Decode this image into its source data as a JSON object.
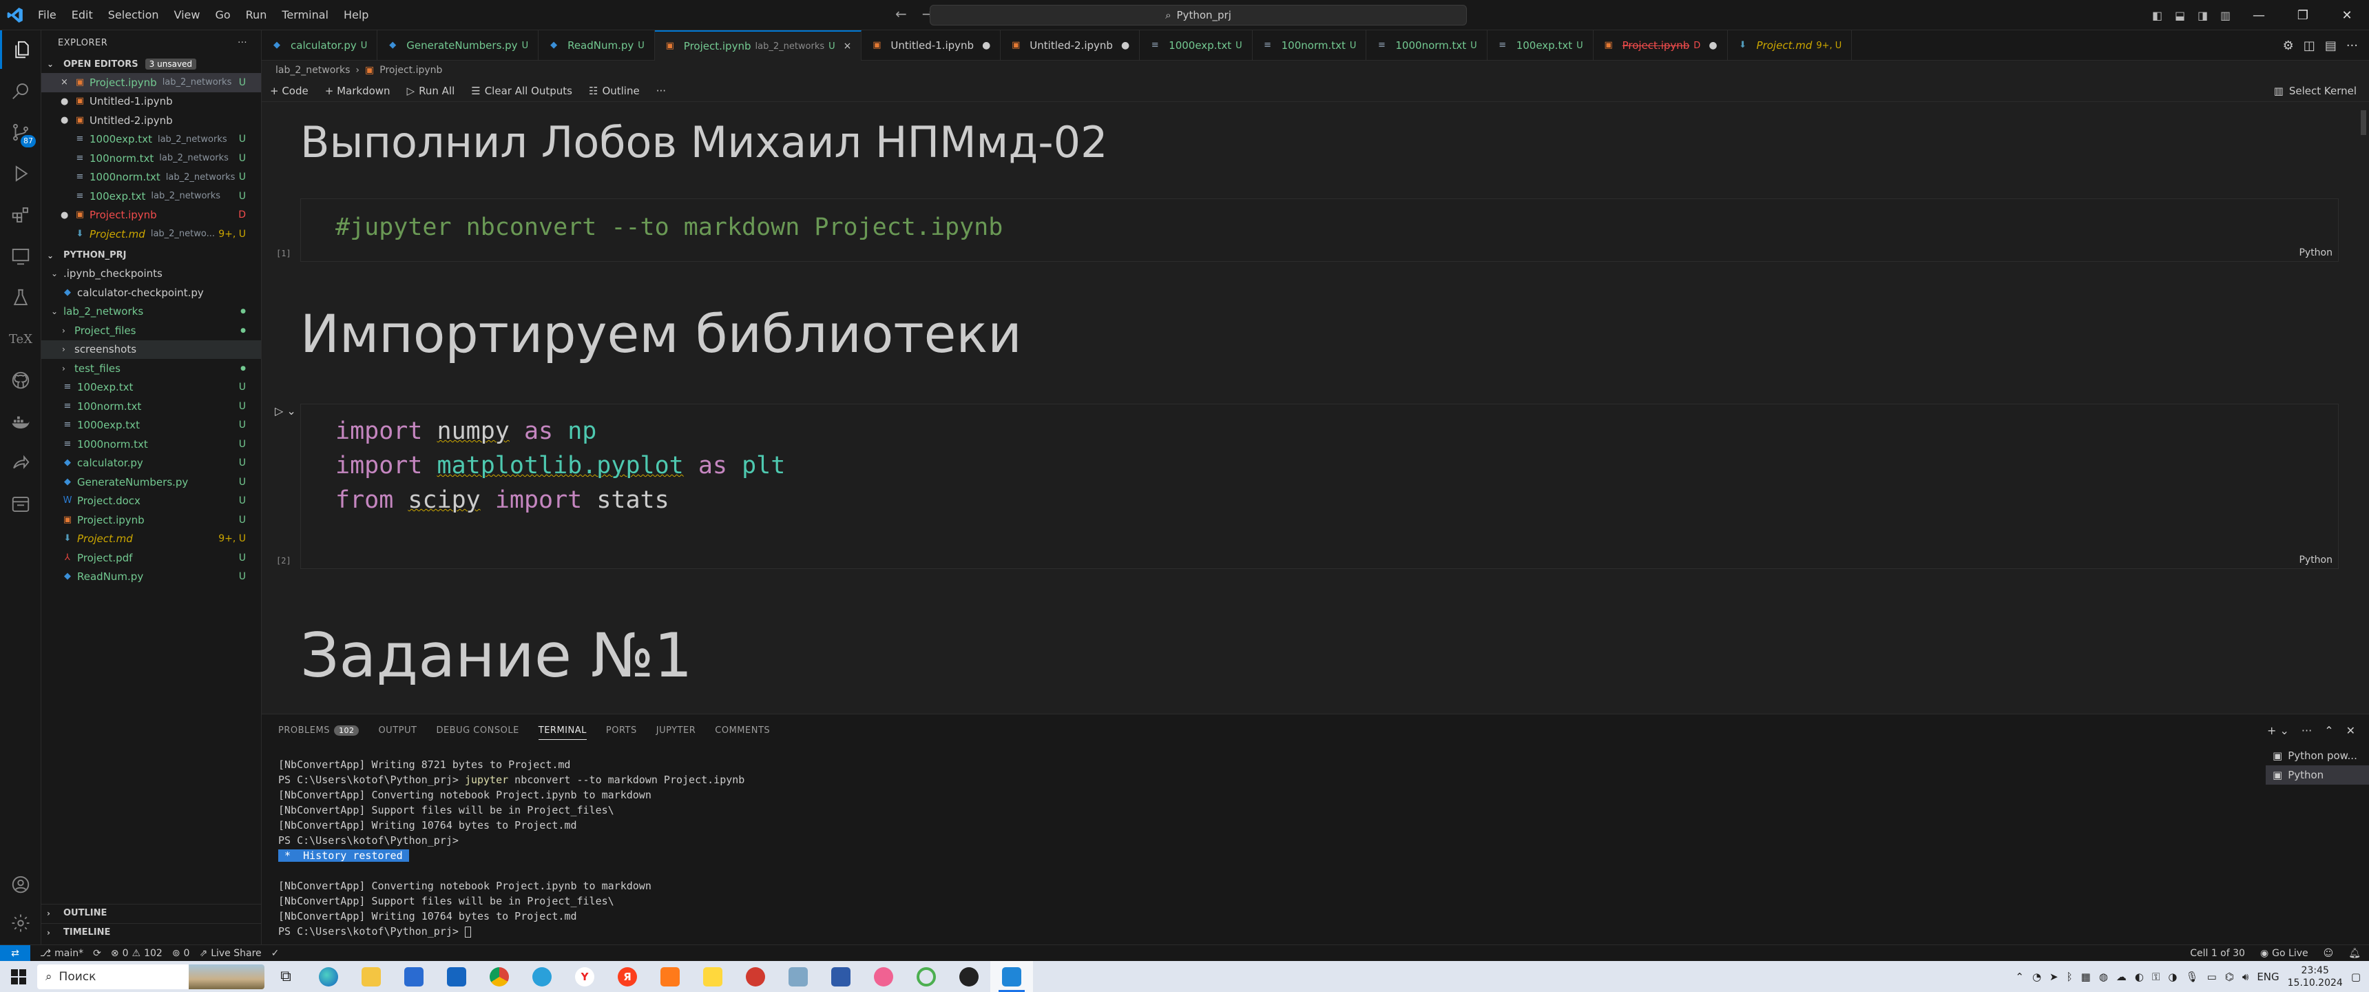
{
  "menu": [
    "File",
    "Edit",
    "Selection",
    "View",
    "Go",
    "Run",
    "Terminal",
    "Help"
  ],
  "search_box": "Python_prj",
  "explorer": {
    "title": "EXPLORER",
    "open_editors_label": "OPEN EDITORS",
    "unsaved_badge": "3 unsaved",
    "open_editors": [
      {
        "name": "Project.ipynb",
        "desc": "lab_2_networks",
        "status": "U",
        "color": "#73c991",
        "lead": "×",
        "selected": true,
        "icon": "nb"
      },
      {
        "name": "Untitled-1.ipynb",
        "desc": "",
        "status": "",
        "color": "#cccccc",
        "lead": "●",
        "icon": "nb"
      },
      {
        "name": "Untitled-2.ipynb",
        "desc": "",
        "status": "",
        "color": "#cccccc",
        "lead": "●",
        "icon": "nb"
      },
      {
        "name": "1000exp.txt",
        "desc": "lab_2_networks",
        "status": "U",
        "color": "#73c991",
        "lead": "",
        "icon": "txt"
      },
      {
        "name": "100norm.txt",
        "desc": "lab_2_networks",
        "status": "U",
        "color": "#73c991",
        "lead": "",
        "icon": "txt"
      },
      {
        "name": "1000norm.txt",
        "desc": "lab_2_networks",
        "status": "U",
        "color": "#73c991",
        "lead": "",
        "icon": "txt"
      },
      {
        "name": "100exp.txt",
        "desc": "lab_2_networks",
        "status": "U",
        "color": "#73c991",
        "lead": "",
        "icon": "txt"
      },
      {
        "name": "Project.ipynb",
        "desc": "",
        "status": "D",
        "color": "#f14c4c",
        "lead": "●",
        "icon": "nb"
      },
      {
        "name": "Project.md",
        "desc": "lab_2_netwo...",
        "status": "9+, U",
        "color": "#cca700",
        "lead": "",
        "icon": "md"
      }
    ],
    "project_label": "PYTHON_PRJ",
    "tree": [
      {
        "name": ".ipynb_checkpoints",
        "indent": 0,
        "folder": "open",
        "color": "#cccccc",
        "status": ""
      },
      {
        "name": "calculator-checkpoint.py",
        "indent": 1,
        "icon": "py",
        "color": "#cccccc",
        "status": ""
      },
      {
        "name": "lab_2_networks",
        "indent": 0,
        "folder": "open",
        "color": "#73c991",
        "status": "●"
      },
      {
        "name": "Project_files",
        "indent": 1,
        "folder": "closed",
        "color": "#73c991",
        "status": "●"
      },
      {
        "name": "screenshots",
        "indent": 1,
        "folder": "closed",
        "color": "#cccccc",
        "status": "",
        "hover": true
      },
      {
        "name": "test_files",
        "indent": 1,
        "folder": "closed",
        "color": "#73c991",
        "status": "●"
      },
      {
        "name": "100exp.txt",
        "indent": 1,
        "icon": "txt",
        "color": "#73c991",
        "status": "U"
      },
      {
        "name": "100norm.txt",
        "indent": 1,
        "icon": "txt",
        "color": "#73c991",
        "status": "U"
      },
      {
        "name": "1000exp.txt",
        "indent": 1,
        "icon": "txt",
        "color": "#73c991",
        "status": "U"
      },
      {
        "name": "1000norm.txt",
        "indent": 1,
        "icon": "txt",
        "color": "#73c991",
        "status": "U"
      },
      {
        "name": "calculator.py",
        "indent": 1,
        "icon": "py",
        "color": "#73c991",
        "status": "U"
      },
      {
        "name": "GenerateNumbers.py",
        "indent": 1,
        "icon": "py",
        "color": "#73c991",
        "status": "U"
      },
      {
        "name": "Project.docx",
        "indent": 1,
        "icon": "docx",
        "color": "#73c991",
        "status": "U"
      },
      {
        "name": "Project.ipynb",
        "indent": 1,
        "icon": "nb",
        "color": "#73c991",
        "status": "U"
      },
      {
        "name": "Project.md",
        "indent": 1,
        "icon": "md",
        "color": "#cca700",
        "status": "9+, U"
      },
      {
        "name": "Project.pdf",
        "indent": 1,
        "icon": "pdf",
        "color": "#73c991",
        "status": "U"
      },
      {
        "name": "ReadNum.py",
        "indent": 1,
        "icon": "py",
        "color": "#73c991",
        "status": "U"
      }
    ],
    "outline_label": "OUTLINE",
    "timeline_label": "TIMELINE"
  },
  "tabs": [
    {
      "name": "calculator.py",
      "desc": "",
      "status": "U",
      "color": "#73c991",
      "icon": "py"
    },
    {
      "name": "GenerateNumbers.py",
      "desc": "",
      "status": "U",
      "color": "#73c991",
      "icon": "py"
    },
    {
      "name": "ReadNum.py",
      "desc": "",
      "status": "U",
      "color": "#73c991",
      "icon": "py"
    },
    {
      "name": "Project.ipynb",
      "desc": "lab_2_networks",
      "status": "U",
      "color": "#73c991",
      "icon": "nb",
      "active": true,
      "close": "×"
    },
    {
      "name": "Untitled-1.ipynb",
      "desc": "",
      "status": "",
      "color": "#cccccc",
      "icon": "nb",
      "close": "●"
    },
    {
      "name": "Untitled-2.ipynb",
      "desc": "",
      "status": "",
      "color": "#cccccc",
      "icon": "nb",
      "close": "●"
    },
    {
      "name": "1000exp.txt",
      "desc": "",
      "status": "U",
      "color": "#73c991",
      "icon": "txt"
    },
    {
      "name": "100norm.txt",
      "desc": "",
      "status": "U",
      "color": "#73c991",
      "icon": "txt"
    },
    {
      "name": "1000norm.txt",
      "desc": "",
      "status": "U",
      "color": "#73c991",
      "icon": "txt"
    },
    {
      "name": "100exp.txt",
      "desc": "",
      "status": "U",
      "color": "#73c991",
      "icon": "txt"
    },
    {
      "name": "Project.ipynb",
      "desc": "",
      "status": "D",
      "color": "#f14c4c",
      "icon": "nb",
      "close": "●",
      "strike": true
    },
    {
      "name": "Project.md",
      "desc": "",
      "status": "9+, U",
      "color": "#cca700",
      "icon": "md",
      "italic": true
    }
  ],
  "breadcrumb": [
    "lab_2_networks",
    "Project.ipynb"
  ],
  "nb_toolbar": [
    "+ Code",
    "+ Markdown",
    "Run All",
    "Clear All Outputs",
    "Outline"
  ],
  "kernel": "Select Kernel",
  "notebook": {
    "h1": "Выполнил Лобов Михаил НПМмд-02",
    "cell1_exec": "[1]",
    "cell1_code": "#jupyter nbconvert --to markdown Project.ipynb",
    "lang": "Python",
    "h2": "Импортируем библиотеки",
    "cell2_exec": "[2]",
    "line1": {
      "kw1": "import",
      "mod": "numpy",
      "as": "as",
      "alias": "np"
    },
    "line2": {
      "kw1": "import",
      "mod": "matplotlib.pyplot",
      "as": "as",
      "alias": "plt"
    },
    "line3": {
      "kw1": "from",
      "mod": "scipy",
      "kw2": "import",
      "name": "stats"
    },
    "h3": "Задание №1"
  },
  "panel": {
    "tabs": [
      "PROBLEMS",
      "OUTPUT",
      "DEBUG CONSOLE",
      "TERMINAL",
      "PORTS",
      "JUPYTER",
      "COMMENTS"
    ],
    "problems_count": "102",
    "terminal_lines_a": [
      "[NbConvertApp] Writing 8721 bytes to Project.md"
    ],
    "prompt": "PS C:\\Users\\kotof\\Python_prj> ",
    "cmd": "jupyter",
    "cmd_rest": " nbconvert --to markdown Project.ipynb",
    "terminal_lines_b": [
      "[NbConvertApp] Converting notebook Project.ipynb to markdown",
      "[NbConvertApp] Support files will be in Project_files\\",
      "[NbConvertApp] Writing 10764 bytes to Project.md",
      "PS C:\\Users\\kotof\\Python_prj>"
    ],
    "history": " *  History restored ",
    "terminal_lines_c": [
      "[NbConvertApp] Converting notebook Project.ipynb to markdown",
      "[NbConvertApp] Support files will be in Project_files\\",
      "[NbConvertApp] Writing 10764 bytes to Project.md",
      "PS C:\\Users\\kotof\\Python_prj> "
    ],
    "terminals": [
      "Python pow...",
      "Python"
    ]
  },
  "status": {
    "branch": "main*",
    "errors": "0",
    "warnings": "102",
    "ports": "0",
    "live_share": "Live Share",
    "cell": "Cell 1 of 30",
    "go_live": "Go Live"
  },
  "taskbar": {
    "search": "Поиск",
    "lang": "ENG",
    "time": "23:45",
    "date": "15.10.2024"
  }
}
